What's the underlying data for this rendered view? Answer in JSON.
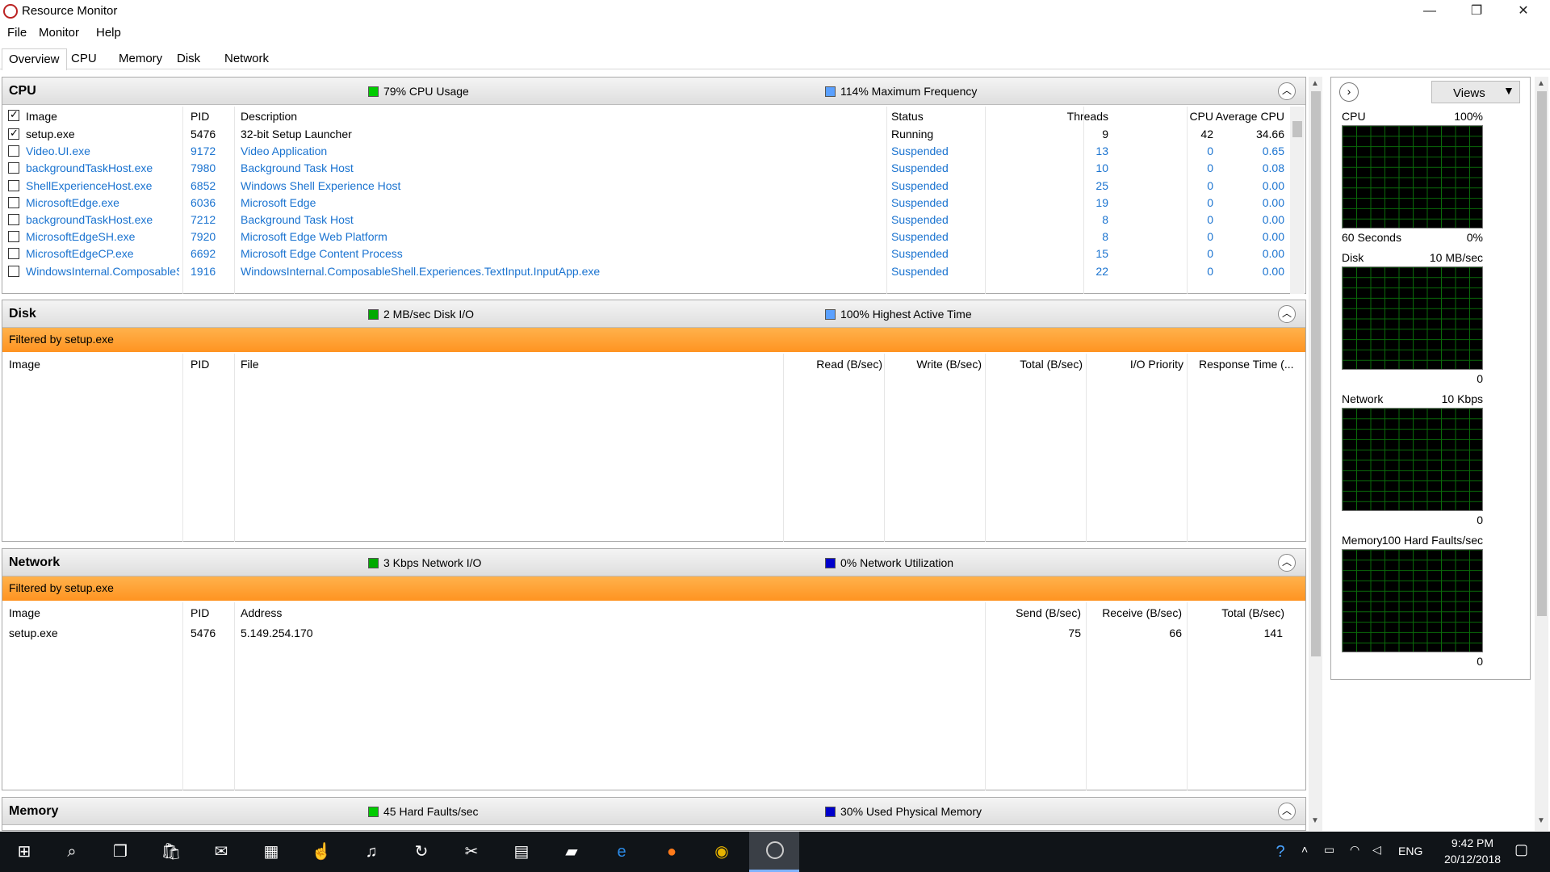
{
  "window": {
    "title": "Resource Monitor",
    "min": "—",
    "restore": "❐",
    "close": "✕"
  },
  "menu": [
    "File",
    "Monitor",
    "Help"
  ],
  "tabs": [
    "Overview",
    "CPU",
    "Memory",
    "Disk",
    "Network"
  ],
  "cpu": {
    "title": "CPU",
    "legend1": "79% CPU Usage",
    "legend1_color": "#00cc00",
    "legend2": "114% Maximum Frequency",
    "legend2_color": "#5aa0ff",
    "columns": [
      "Image",
      "PID",
      "Description",
      "Status",
      "Threads",
      "CPU",
      "Average CPU"
    ],
    "rows": [
      {
        "checked": true,
        "image": "setup.exe",
        "pid": "5476",
        "desc": "32-bit Setup Launcher",
        "status": "Running",
        "threads": "9",
        "cpu": "42",
        "avg": "34.66"
      },
      {
        "checked": false,
        "image": "Video.UI.exe",
        "pid": "9172",
        "desc": "Video Application",
        "status": "Suspended",
        "threads": "13",
        "cpu": "0",
        "avg": "0.65"
      },
      {
        "checked": false,
        "image": "backgroundTaskHost.exe",
        "pid": "7980",
        "desc": "Background Task Host",
        "status": "Suspended",
        "threads": "10",
        "cpu": "0",
        "avg": "0.08"
      },
      {
        "checked": false,
        "image": "ShellExperienceHost.exe",
        "pid": "6852",
        "desc": "Windows Shell Experience Host",
        "status": "Suspended",
        "threads": "25",
        "cpu": "0",
        "avg": "0.00"
      },
      {
        "checked": false,
        "image": "MicrosoftEdge.exe",
        "pid": "6036",
        "desc": "Microsoft Edge",
        "status": "Suspended",
        "threads": "19",
        "cpu": "0",
        "avg": "0.00"
      },
      {
        "checked": false,
        "image": "backgroundTaskHost.exe",
        "pid": "7212",
        "desc": "Background Task Host",
        "status": "Suspended",
        "threads": "8",
        "cpu": "0",
        "avg": "0.00"
      },
      {
        "checked": false,
        "image": "MicrosoftEdgeSH.exe",
        "pid": "7920",
        "desc": "Microsoft Edge Web Platform",
        "status": "Suspended",
        "threads": "8",
        "cpu": "0",
        "avg": "0.00"
      },
      {
        "checked": false,
        "image": "MicrosoftEdgeCP.exe",
        "pid": "6692",
        "desc": "Microsoft Edge Content Process",
        "status": "Suspended",
        "threads": "15",
        "cpu": "0",
        "avg": "0.00"
      },
      {
        "checked": false,
        "image": "WindowsInternal.ComposableS...",
        "pid": "1916",
        "desc": "WindowsInternal.ComposableShell.Experiences.TextInput.InputApp.exe",
        "status": "Suspended",
        "threads": "22",
        "cpu": "0",
        "avg": "0.00"
      }
    ]
  },
  "disk": {
    "title": "Disk",
    "legend1": "2 MB/sec Disk I/O",
    "legend1_color": "#00aa00",
    "legend2": "100% Highest Active Time",
    "legend2_color": "#5aa0ff",
    "filter": "Filtered by setup.exe",
    "columns": [
      "Image",
      "PID",
      "File",
      "Read (B/sec)",
      "Write (B/sec)",
      "Total (B/sec)",
      "I/O Priority",
      "Response Time (..."
    ]
  },
  "network": {
    "title": "Network",
    "legend1": "3 Kbps Network I/O",
    "legend1_color": "#00aa00",
    "legend2": "0% Network Utilization",
    "legend2_color": "#0000cc",
    "filter": "Filtered by setup.exe",
    "columns": [
      "Image",
      "PID",
      "Address",
      "Send (B/sec)",
      "Receive (B/sec)",
      "Total (B/sec)"
    ],
    "rows": [
      {
        "image": "setup.exe",
        "pid": "5476",
        "address": "5.149.254.170",
        "send": "75",
        "receive": "66",
        "total": "141"
      }
    ]
  },
  "memory": {
    "title": "Memory",
    "legend1": "45 Hard Faults/sec",
    "legend1_color": "#00cc00",
    "legend2": "30% Used Physical Memory",
    "legend2_color": "#0000cc"
  },
  "side": {
    "views_label": "Views",
    "graphs": [
      {
        "name": "CPU",
        "max": "100%",
        "left_bottom": "60 Seconds",
        "min": "0%"
      },
      {
        "name": "Disk",
        "max": "10 MB/sec",
        "left_bottom": "",
        "min": "0"
      },
      {
        "name": "Network",
        "max": "10 Kbps",
        "left_bottom": "",
        "min": "0"
      },
      {
        "name": "Memory",
        "max": "100 Hard Faults/sec",
        "left_bottom": "",
        "min": "0"
      }
    ]
  },
  "taskbar": {
    "time": "9:42 PM",
    "date": "20/12/2018",
    "lang": "ENG"
  }
}
